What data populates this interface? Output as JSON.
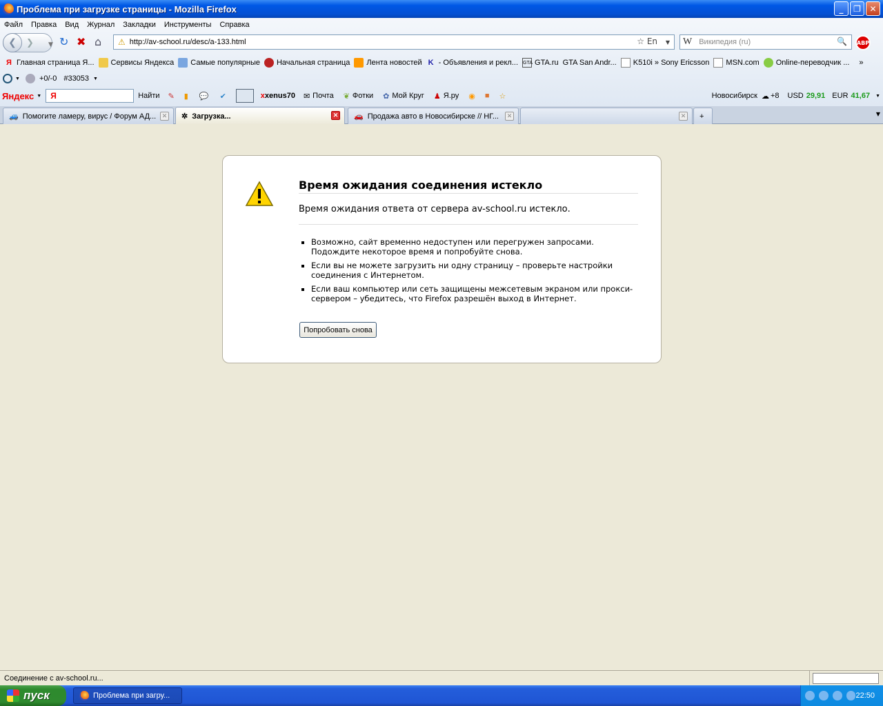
{
  "window": {
    "title": "Проблема при загрузке страницы - Mozilla Firefox"
  },
  "menu": [
    "Файл",
    "Правка",
    "Вид",
    "Журнал",
    "Закладки",
    "Инструменты",
    "Справка"
  ],
  "navbar": {
    "url": "http://av-school.ru/desc/a-133.html",
    "lang_indicator": "En",
    "search_placeholder": "Википедия (ru)",
    "search_engine_letter": "W",
    "abp_label": "ABP"
  },
  "bookmarks": [
    {
      "label": "Главная страница Я...",
      "icon": "yandex-icon"
    },
    {
      "label": "Сервисы Яндекса",
      "icon": "folder-icon"
    },
    {
      "label": "Самые популярные",
      "icon": "popular-icon"
    },
    {
      "label": "Начальная страница",
      "icon": "firefox-icon"
    },
    {
      "label": "Лента новостей",
      "icon": "rss-icon"
    },
    {
      "label": "- Объявления и рекл...",
      "icon": "k-icon"
    },
    {
      "label": "GTA.ru",
      "icon": "gta-icon"
    },
    {
      "label": "GTA San Andr...",
      "icon": "page-icon"
    },
    {
      "label": "K510i » Sony Ericsson",
      "icon": "page-icon"
    },
    {
      "label": "MSN.com",
      "icon": "page-icon"
    },
    {
      "label": "Online-переводчик ...",
      "icon": "translate-icon"
    }
  ],
  "extbar": {
    "counter": "+0/-0",
    "number": "#33053"
  },
  "yandexbar": {
    "logo": "Яндекс",
    "input_value": "Я",
    "find_label": "Найти",
    "user": "xenus70",
    "mail": "Почта",
    "photos": "Фотки",
    "circle": "Мой Круг",
    "yaru": "Я.ру",
    "city": "Новосибирск",
    "temp": "+8",
    "usd_label": "USD",
    "usd_value": "29,91",
    "eur_label": "EUR",
    "eur_value": "41,67"
  },
  "tabs": [
    {
      "label": "Помогите ламеру, вирус / Форум АД...",
      "selected": false
    },
    {
      "label": "Загрузка...",
      "selected": true
    },
    {
      "label": "Продажа авто в Новосибирске // НГ...",
      "selected": false
    }
  ],
  "error": {
    "title": "Время ожидания соединения истекло",
    "short": "Время ожидания ответа от сервера av-school.ru истекло.",
    "items": [
      "Возможно, сайт временно недоступен или перегружен запросами. Подождите некоторое время и попробуйте снова.",
      "Если вы не можете загрузить ни одну страницу – проверьте настройки соединения с Интернетом.",
      "Если ваш компьютер или сеть защищены межсетевым экраном или прокси-сервером – убедитесь, что Firefox разрешён выход в Интернет."
    ],
    "retry_label": "Попробовать снова"
  },
  "status": {
    "text": "Соединение с av-school.ru..."
  },
  "taskbar": {
    "start_label": "пуск",
    "task_label": "Проблема при загру...",
    "clock": "22:50"
  },
  "colors": {
    "accent": "#0058e6",
    "usd_color": "#1a9a1a",
    "eur_color": "#1a9a1a"
  }
}
